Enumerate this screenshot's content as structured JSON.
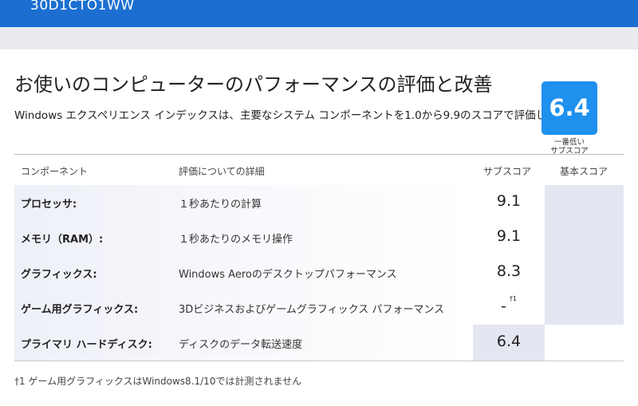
{
  "header": {
    "model": "30D1CTO1WW"
  },
  "page": {
    "title": "お使いのコンピューターのパフォーマンスの評価と改善",
    "description": "Windows エクスペリエンス インデックスは、主要なシステム コンポーネントを1.0から9.9のスコアで評価した値です。"
  },
  "table": {
    "headers": {
      "component": "コンポーネント",
      "detail": "評価についての詳細",
      "subscore": "サブスコア",
      "basescore": "基本スコア"
    },
    "rows": [
      {
        "name": "プロセッサ:",
        "detail": "１秒あたりの計算",
        "score": "9.1",
        "note": ""
      },
      {
        "name": "メモリ（RAM）:",
        "detail": "１秒あたりのメモリ操作",
        "score": "9.1",
        "note": ""
      },
      {
        "name": "グラフィックス:",
        "detail": "Windows Aeroのデスクトップパフォーマンス",
        "score": "8.3",
        "note": ""
      },
      {
        "name": "ゲーム用グラフィックス:",
        "detail": "3Dビジネスおよびゲームグラフィックス パフォーマンス",
        "score": "-",
        "note": "†1"
      },
      {
        "name": "プライマリ ハードディスク:",
        "detail": "ディスクのデータ転送速度",
        "score": "6.4",
        "note": ""
      }
    ],
    "base": {
      "score": "6.4",
      "caption_line1": "一番低い",
      "caption_line2": "サブスコア"
    }
  },
  "footnote": "†1 ゲーム用グラフィックスはWindows8.1/10では計測されません",
  "colors": {
    "topbar": "#1c6fd1",
    "badge": "#1e90ee",
    "base_column": "#e4e6f1"
  }
}
